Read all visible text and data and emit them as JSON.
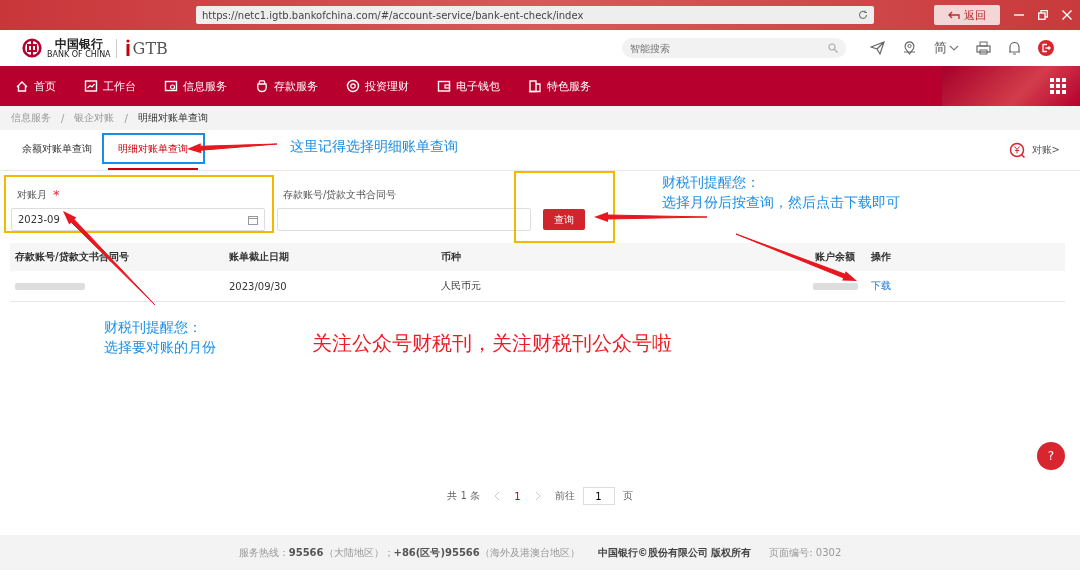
{
  "browser": {
    "url": "https://netc1.igtb.bankofchina.com/#/account-service/bank-ent-check/index",
    "back_button": "返回"
  },
  "header": {
    "logo_cn": "中国银行",
    "logo_en": "BANK OF CHINA",
    "logo_product": "GTB",
    "search": {
      "placeholder": "智能搜索"
    },
    "language": "简"
  },
  "nav": {
    "items": [
      "首页",
      "工作台",
      "信息服务",
      "存款服务",
      "投资理财",
      "电子钱包",
      "特色服务"
    ]
  },
  "breadcrumb": {
    "separator": "/",
    "items": [
      "信息服务",
      "银企对账",
      "明细对账单查询"
    ]
  },
  "tabs": [
    {
      "label": "余额对账单查询",
      "selected": false
    },
    {
      "label": "明细对账单查询",
      "selected": true
    }
  ],
  "reconcile_link": "对账>",
  "form": {
    "month": {
      "label": "对账月",
      "required": true,
      "required_mark": "*",
      "value": "2023-09"
    },
    "account": {
      "label": "存款账号/贷款文书合同号"
    },
    "query_button": "查询"
  },
  "table": {
    "columns": [
      "存款账号/贷款文书合同号",
      "账单截止日期",
      "币种",
      "账户余额",
      "操作"
    ],
    "rows": [
      {
        "date": "2023/09/30",
        "currency": "人民币元",
        "action": "下载"
      }
    ]
  },
  "pagination": {
    "total": "共 1 条",
    "pages": [
      {
        "label": "1",
        "selected": true
      }
    ],
    "goto_label": "前往",
    "goto_value": "1",
    "page_unit": "页"
  },
  "help_button": "?",
  "annotations": {
    "tab_note": "这里记得选择明细账单查询",
    "query_note": [
      "财税刊提醒您：",
      "选择月份后按查询，然后点击下载即可"
    ],
    "month_note": [
      "财税刊提醒您：",
      "选择要对账的月份"
    ],
    "promo": "关注公众号财税刊，关注财税刊公众号啦"
  },
  "footer": {
    "hotline": "服务热线：**95566**（大陆地区）；**+86(区号)95566**（海外及港澳台地区）",
    "copyright": "中国银行©股份有限公司 版权所有",
    "page_code": "页面编号: 0302"
  }
}
